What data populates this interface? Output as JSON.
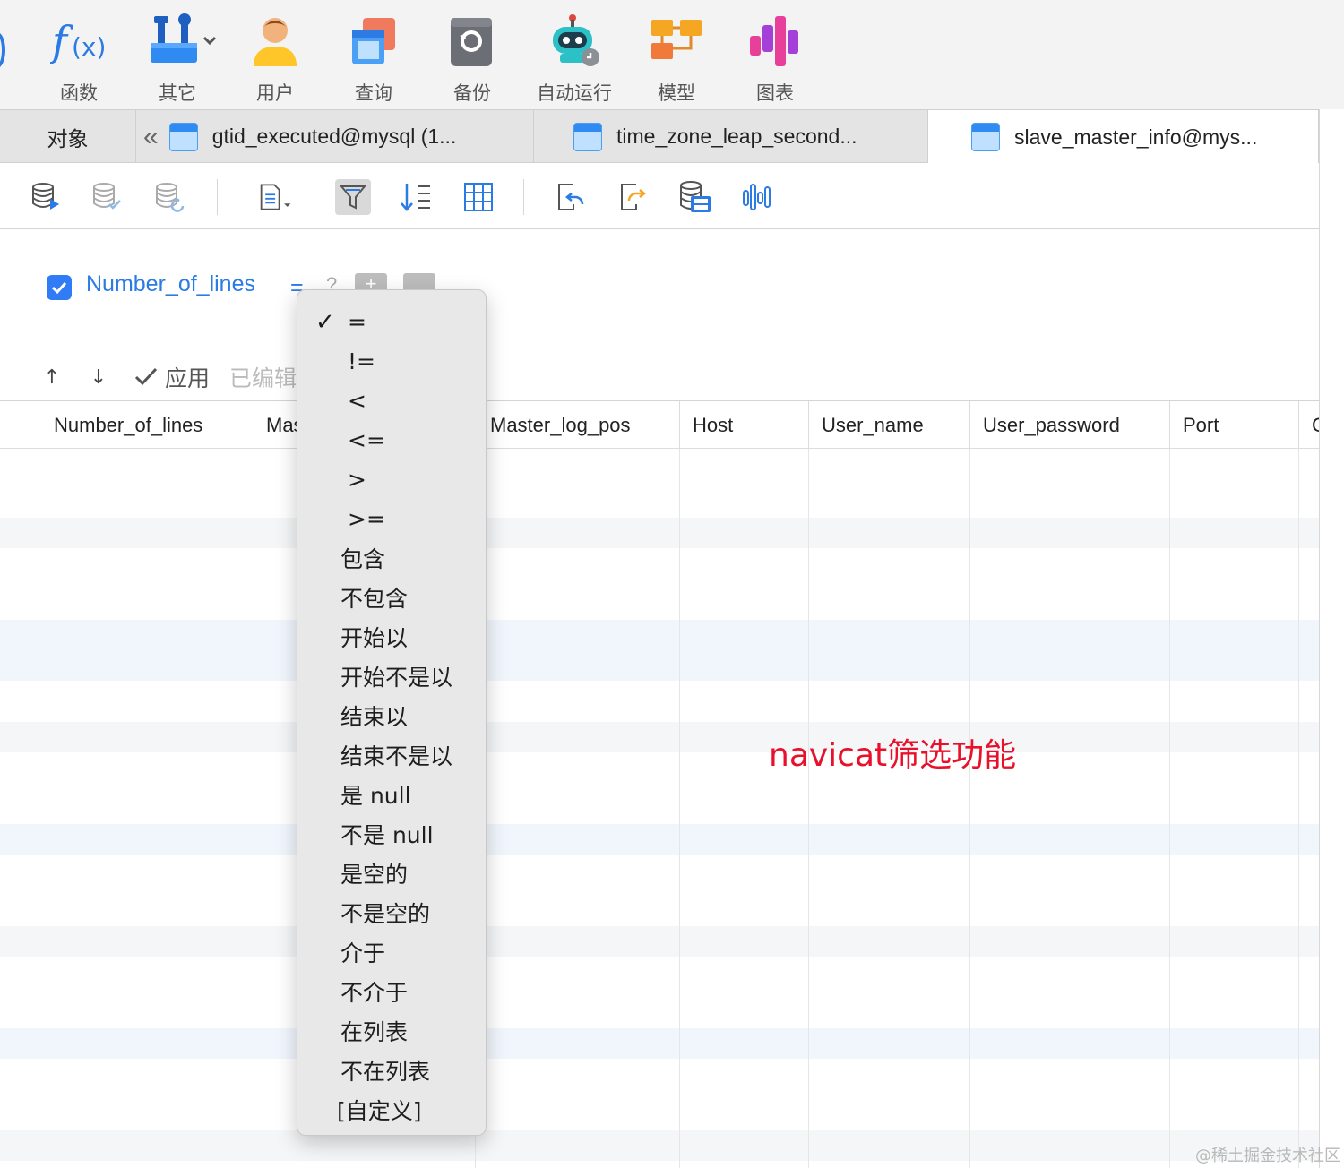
{
  "toolbar": {
    "items": [
      {
        "label": "函数",
        "icon": "function-icon"
      },
      {
        "label": "其它",
        "icon": "tools-icon"
      },
      {
        "label": "用户",
        "icon": "user-icon"
      },
      {
        "label": "查询",
        "icon": "query-icon"
      },
      {
        "label": "备份",
        "icon": "backup-icon"
      },
      {
        "label": "自动运行",
        "icon": "robot-icon"
      },
      {
        "label": "模型",
        "icon": "model-icon"
      },
      {
        "label": "图表",
        "icon": "chart-icon"
      }
    ],
    "fx_glyph": "f(x)",
    "accent": "#2a7be4"
  },
  "tabs": {
    "objects_label": "对象",
    "back_glyph": "«",
    "items": [
      {
        "label": "gtid_executed@mysql (1..."
      },
      {
        "label": "time_zone_leap_second..."
      },
      {
        "label": "slave_master_info@mys...",
        "active": true
      }
    ]
  },
  "subtoolbar": {
    "buttons": [
      "begin-transaction-icon",
      "commit-icon",
      "rollback-icon",
      "text-view-icon",
      "filter-icon",
      "sort-icon",
      "grid-view-icon",
      "import-icon",
      "export-icon",
      "data-generation-icon",
      "chart-wave-icon"
    ]
  },
  "filter": {
    "checkbox_checked": true,
    "field": "Number_of_lines",
    "operator": "=",
    "help": "?",
    "add": "+",
    "actions": {
      "up": "↑",
      "down": "↓",
      "apply": "应用",
      "edited": "已编辑"
    }
  },
  "grid": {
    "columns": [
      {
        "label": "Number_of_lines"
      },
      {
        "label": "Master_log_name"
      },
      {
        "label": "Master_log_pos"
      },
      {
        "label": "Host"
      },
      {
        "label": "User_name"
      },
      {
        "label": "User_password"
      },
      {
        "label": "Port"
      },
      {
        "label": "Connect_retry"
      }
    ]
  },
  "dropdown": {
    "selected_index": 0,
    "items": [
      "=",
      "!=",
      "<",
      "<=",
      ">",
      ">=",
      "包含",
      "不包含",
      "开始以",
      "开始不是以",
      "结束以",
      "结束不是以",
      "是 null",
      "不是 null",
      "是空的",
      "不是空的",
      "介于",
      "不介于",
      "在列表",
      "不在列表",
      "[自定义]"
    ]
  },
  "annotation": "navicat筛选功能",
  "watermark": "@稀土掘金技术社区",
  "colors": {
    "annotation": "#e8102a",
    "link": "#2a7be4",
    "checkbox": "#2f7cf6"
  }
}
